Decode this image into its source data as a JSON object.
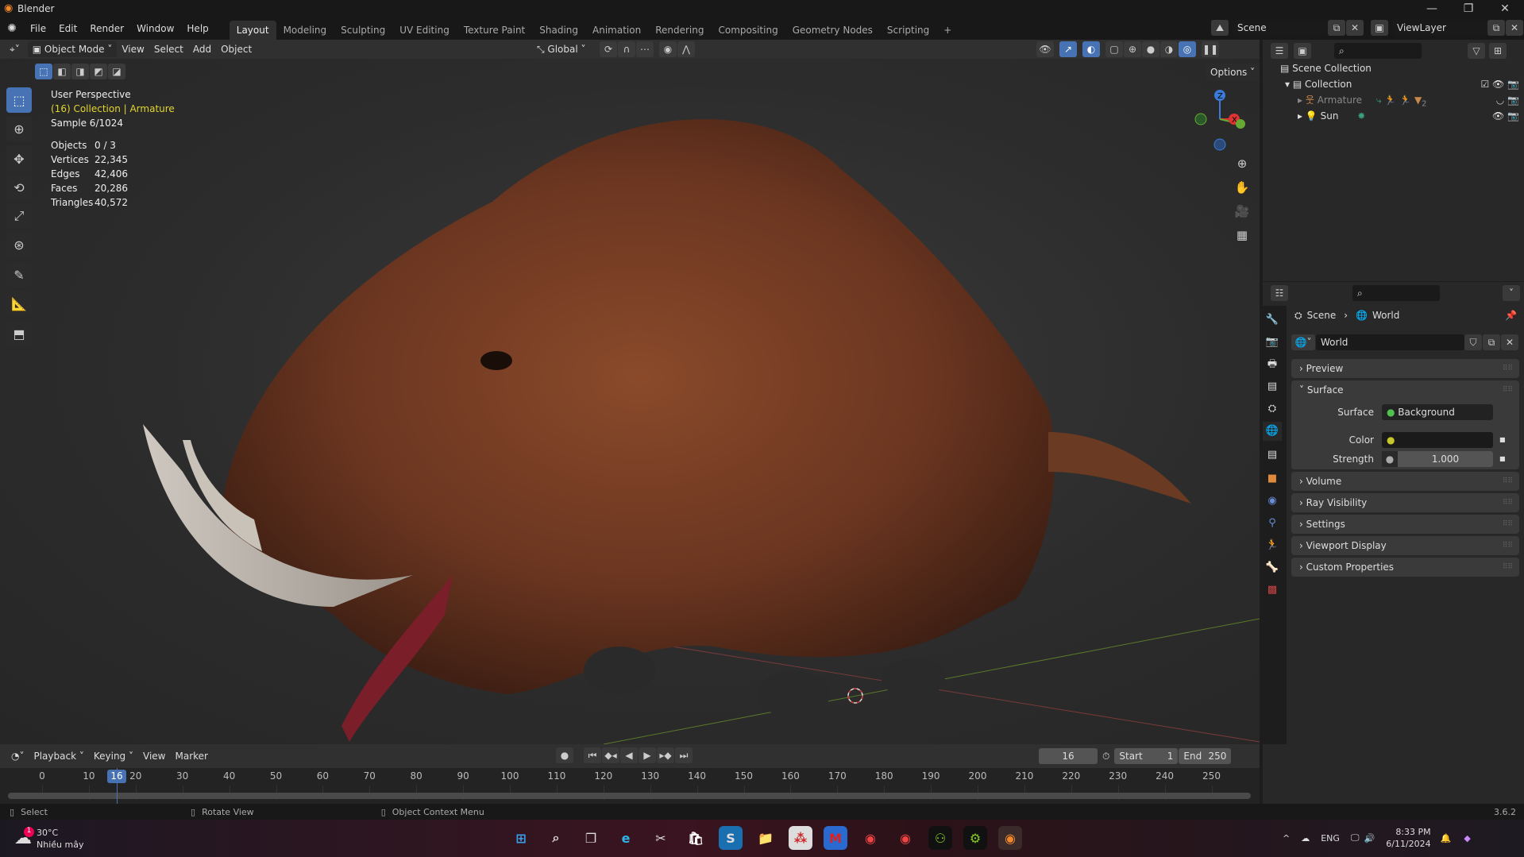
{
  "app": {
    "title": "Blender",
    "version": "3.6.2"
  },
  "menu": [
    "File",
    "Edit",
    "Render",
    "Window",
    "Help"
  ],
  "workspaces": [
    "Layout",
    "Modeling",
    "Sculpting",
    "UV Editing",
    "Texture Paint",
    "Shading",
    "Animation",
    "Rendering",
    "Compositing",
    "Geometry Nodes",
    "Scripting",
    "+"
  ],
  "active_workspace": "Layout",
  "scene": {
    "name": "Scene",
    "view_layer": "ViewLayer"
  },
  "viewport_header": {
    "mode": "Object Mode",
    "menus": [
      "View",
      "Select",
      "Add",
      "Object"
    ],
    "orientation": "Global",
    "options": "Options"
  },
  "overlay": {
    "view_name": "User Perspective",
    "context": "(16) Collection | Armature",
    "sample": "Sample 6/1024",
    "stats": [
      {
        "label": "Objects",
        "value": "0 / 3"
      },
      {
        "label": "Vertices",
        "value": "22,345"
      },
      {
        "label": "Edges",
        "value": "42,406"
      },
      {
        "label": "Faces",
        "value": "20,286"
      },
      {
        "label": "Triangles",
        "value": "40,572"
      }
    ]
  },
  "gizmo": {
    "z": "Z",
    "x": "X"
  },
  "outliner": {
    "root": "Scene Collection",
    "items": [
      {
        "name": "Collection",
        "badge": ""
      },
      {
        "name": "Armature",
        "badge": "2"
      },
      {
        "name": "Sun",
        "badge": ""
      }
    ]
  },
  "properties": {
    "breadcrumb": [
      "Scene",
      "World"
    ],
    "datablock": "World",
    "panels": {
      "preview": "Preview",
      "surface": "Surface",
      "volume": "Volume",
      "ray_visibility": "Ray Visibility",
      "settings": "Settings",
      "viewport_display": "Viewport Display",
      "custom_properties": "Custom Properties"
    },
    "surface_label": "Surface",
    "surface_value": "Background",
    "color_label": "Color",
    "strength_label": "Strength",
    "strength_value": "1.000",
    "colors": {
      "surface_socket": "#4fc14f",
      "color_socket": "#c7c729",
      "strength_socket": "#a1a1a1"
    }
  },
  "timeline": {
    "menus": [
      "Playback",
      "Keying",
      "View",
      "Marker"
    ],
    "current_frame": "16",
    "start_label": "Start",
    "start": "1",
    "end_label": "End",
    "end": "250",
    "ticks": [
      "0",
      "10",
      "20",
      "30",
      "40",
      "50",
      "60",
      "70",
      "80",
      "90",
      "100",
      "110",
      "120",
      "130",
      "140",
      "150",
      "160",
      "170",
      "180",
      "190",
      "200",
      "210",
      "220",
      "230",
      "240",
      "250"
    ]
  },
  "statusbar": {
    "select": "Select",
    "rotate": "Rotate View",
    "context_menu": "Object Context Menu"
  },
  "taskbar": {
    "temp": "30°C",
    "weather": "Nhiều mây",
    "weather_badge": "1",
    "lang": "ENG",
    "time": "8:33 PM",
    "date": "6/11/2024"
  },
  "colors": {
    "accent": "#4772b3",
    "active_text": "#e2d52c",
    "bg": "#303030"
  }
}
